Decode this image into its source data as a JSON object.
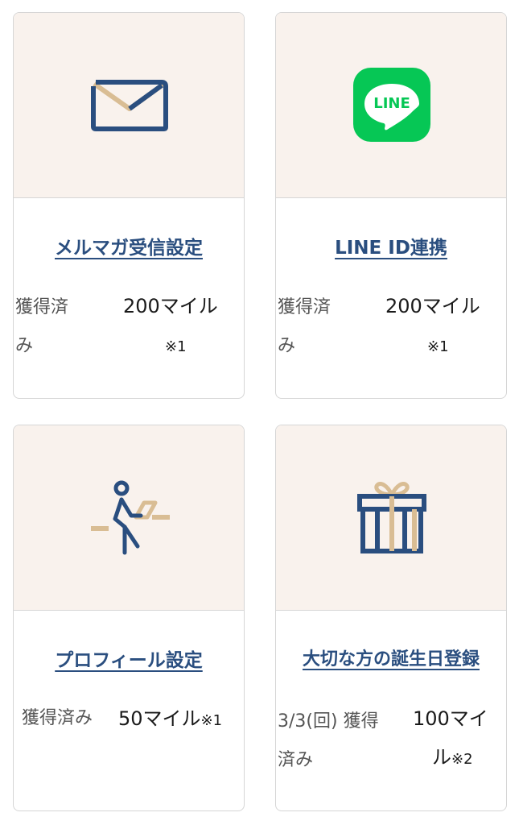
{
  "cards": [
    {
      "title": "メルマガ受信設定",
      "status_line1": "獲得済",
      "status_line2": "み",
      "miles": "200マイル",
      "note": "※1",
      "icon": "envelope-icon"
    },
    {
      "title": "LINE ID連携",
      "status_line1": "獲得済",
      "status_line2": "み",
      "miles": "200マイル",
      "note": "※1",
      "icon": "line-app-icon",
      "icon_text": "LINE"
    },
    {
      "title": "プロフィール設定",
      "status_line1": "獲得済み",
      "miles": "50マイル",
      "note": "※1",
      "icon": "person-laptop-icon"
    },
    {
      "title": "大切な方の誕生日登録",
      "status_line1": "3/3(回) 獲得",
      "status_line2": "済み",
      "miles_line1": "100マイ",
      "miles_line2": "ル",
      "note": "※2",
      "icon": "gift-icon"
    }
  ],
  "colors": {
    "navy": "#2a4e7f",
    "beige": "#d9bd94",
    "line_green": "#06c755",
    "thumb_bg": "#f9f2ed",
    "border": "#d6d6d6"
  }
}
